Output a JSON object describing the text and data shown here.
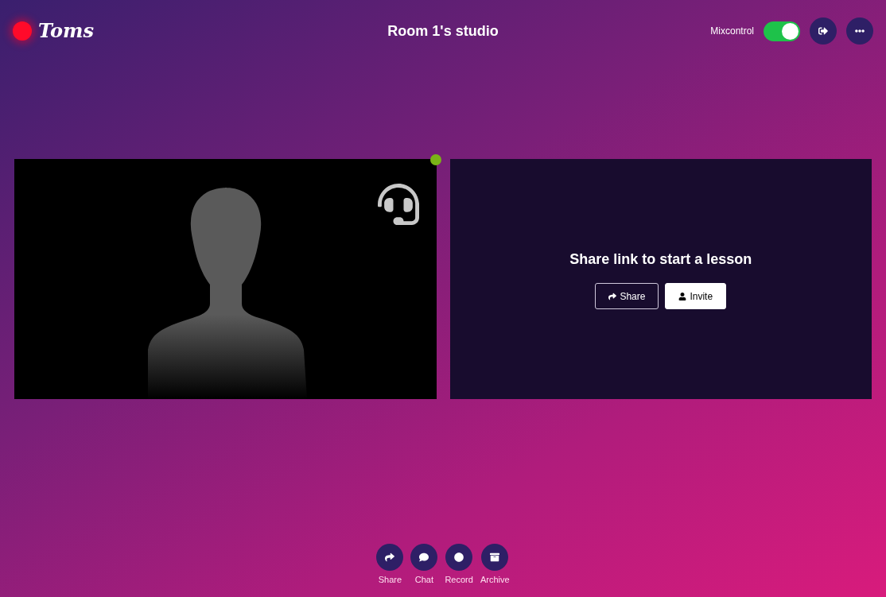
{
  "header": {
    "logo": "Toms",
    "title": "Room 1's studio",
    "mixcontrol": {
      "label": "Mixcontrol",
      "on": true
    },
    "buttons": [
      {
        "kind": "leave"
      },
      {
        "kind": "more"
      }
    ]
  },
  "participant": {
    "headset": true
  },
  "invite_panel": {
    "heading": "Share link to start a lesson",
    "buttons": [
      {
        "kind": "share",
        "label": "Share",
        "selected": false
      },
      {
        "kind": "invite",
        "label": "Invite",
        "selected": true
      }
    ]
  },
  "toolbar": [
    {
      "kind": "share",
      "label": "Share"
    },
    {
      "kind": "chat",
      "label": "Chat"
    },
    {
      "kind": "record",
      "label": "Record"
    },
    {
      "kind": "archive",
      "label": "Archive"
    }
  ]
}
